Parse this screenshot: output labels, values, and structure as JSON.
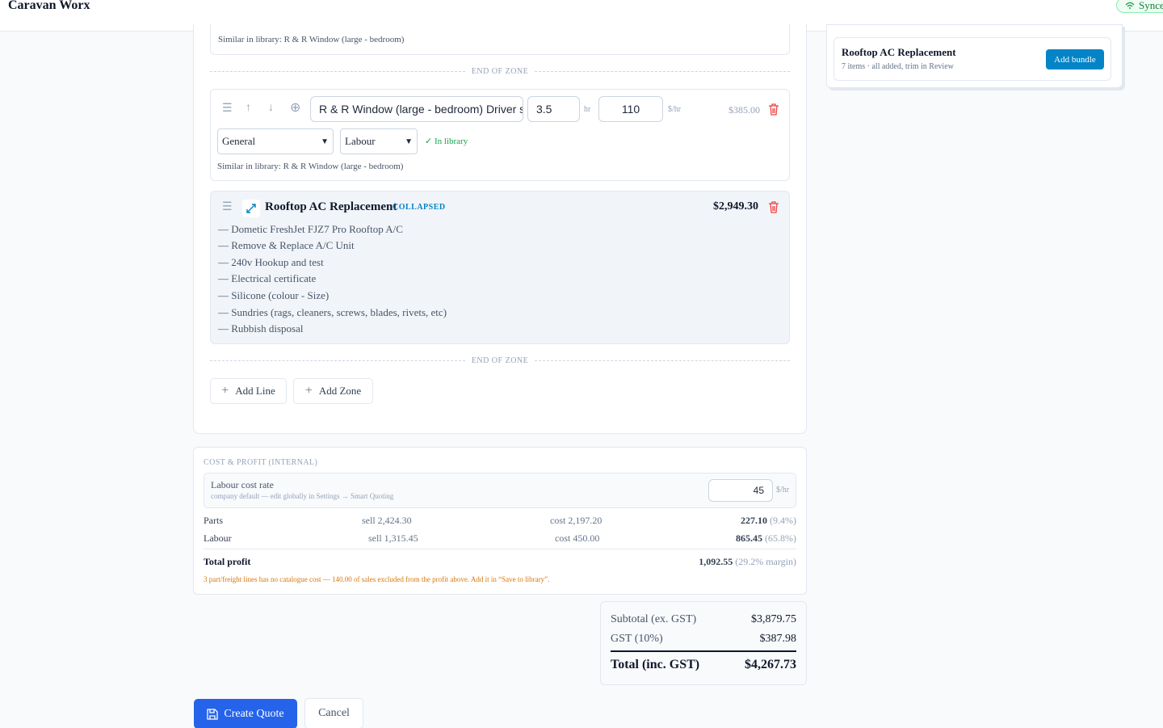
{
  "header": {
    "brand": "Caravan Worx",
    "sync_status": "Synced"
  },
  "zones": {
    "end_label": "END OF ZONE",
    "prev_line_similar": "Similar in library: R & R Window (large - bedroom)"
  },
  "line": {
    "description": "R & R Window (large - bedroom) Driver side",
    "qty": "3.5",
    "qty_unit": "hr",
    "rate": "110",
    "rate_unit": "$/hr",
    "total": "$385.00",
    "category": "General",
    "type": "Labour",
    "library_status": "In library",
    "similar": "Similar in library: R & R Window (large - bedroom)"
  },
  "bundle": {
    "title": "Rooftop AC Replacement",
    "badge": "COLLAPSED",
    "total": "$2,949.30",
    "items": [
      "— Dometic FreshJet FJZ7 Pro Rooftop A/C",
      "— Remove & Replace A/C Unit",
      "— 240v Hookup and test",
      "— Electrical certificate",
      "— Silicone (colour - Size)",
      "— Sundries (rags, cleaners, screws, blades, rivets, etc)",
      "— Rubbish disposal"
    ]
  },
  "actions": {
    "add_line": "Add Line",
    "add_zone": "Add Zone"
  },
  "sidebar": {
    "bundle_title": "Rooftop AC Replacement",
    "bundle_meta": "7 items · all added, trim in Review",
    "add_bundle": "Add bundle"
  },
  "cost": {
    "heading": "COST & PROFIT (INTERNAL)",
    "labour_rate_label": "Labour cost rate",
    "labour_rate_hint": "company default — edit globally in Settings → Smart Quoting",
    "labour_rate_value": "45",
    "labour_rate_unit": "$/hr",
    "rows": [
      {
        "label": "Parts",
        "sell": "sell 2,424.30",
        "cost": "cost 2,197.20",
        "profit": "227.10",
        "pct": "(9.4%)"
      },
      {
        "label": "Labour",
        "sell": "sell 1,315.45",
        "cost": "cost 450.00",
        "profit": "865.45",
        "pct": "(65.8%)"
      }
    ],
    "total_label": "Total profit",
    "total_value": "1,092.55",
    "total_margin": "(29.2% margin)",
    "warning": "3 part/freight lines has no catalogue cost — 140.00 of sales excluded from the profit above. Add it in “Save to library”."
  },
  "totals": {
    "subtotal_label": "Subtotal (ex. GST)",
    "subtotal_value": "$3,879.75",
    "gst_label": "GST (10%)",
    "gst_value": "$387.98",
    "total_label": "Total (inc. GST)",
    "total_value": "$4,267.73"
  },
  "footer": {
    "create": "Create Quote",
    "cancel": "Cancel"
  },
  "colors": {
    "primary": "#2563eb",
    "accent": "#0284c7",
    "warning": "#d97706",
    "danger": "#ef4444",
    "success": "#16a34a"
  }
}
